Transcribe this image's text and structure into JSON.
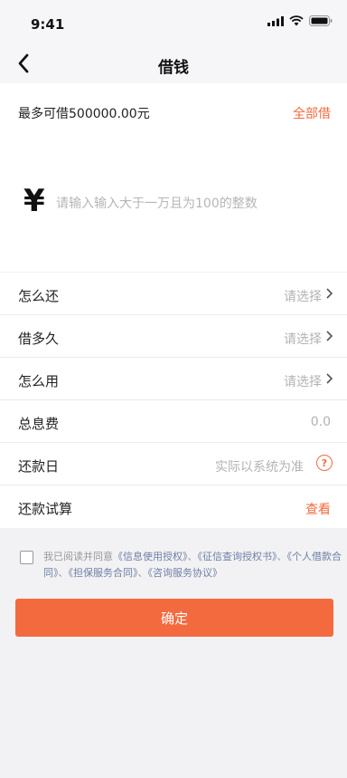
{
  "status_bar": {
    "time": "9:41"
  },
  "nav": {
    "title": "借钱"
  },
  "amount": {
    "max_label": "最多可借500000.00元",
    "all_label": "全部借",
    "currency_symbol": "¥",
    "placeholder": "请输入输入大于一万且为100的整数"
  },
  "options": [
    {
      "label": "怎么还",
      "value": "请选择"
    },
    {
      "label": "借多久",
      "value": "请选择"
    },
    {
      "label": "怎么用",
      "value": "请选择"
    },
    {
      "label": "总息费",
      "value": "0.0"
    },
    {
      "label": "还款日",
      "value": "实际以系统为准"
    },
    {
      "label": "还款试算",
      "value": "查看"
    }
  ],
  "agreement": {
    "prefix": "我已阅读并同意",
    "link1": "《信息使用授权》",
    "sep1": "、",
    "link2": "《征信查询授权书》",
    "sep2": "、",
    "link3": "《个人借款合同》",
    "sep3": "、",
    "link4": "《担保服务合同》",
    "sep4": "、",
    "link5": "《咨询服务协议》"
  },
  "confirm_label": "确定",
  "colors": {
    "accent": "#f46a3f",
    "link": "#6f7fa6"
  },
  "icons": [
    "signal-icon",
    "wifi-icon",
    "battery-icon",
    "back-arrow-icon",
    "chevron-right-icon",
    "question-circle-icon"
  ]
}
